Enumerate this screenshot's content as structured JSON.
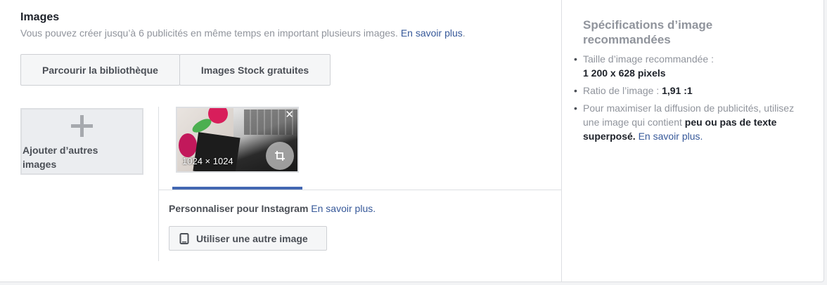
{
  "section": {
    "title": "Images",
    "subtitle": "Vous pouvez créer jusqu’à 6 publicités en même temps en important plusieurs images.",
    "learn_more": "En savoir plus",
    "period": "."
  },
  "buttons": {
    "browse_library": "Parcourir la bibliothèque",
    "stock_images": "Images Stock gratuites",
    "use_other_image": "Utiliser une autre image"
  },
  "add_images": {
    "label": "Ajouter d’autres images"
  },
  "thumbnail": {
    "dimensions": "1024 × 1024",
    "close_glyph": "✕"
  },
  "instagram": {
    "label": "Personnaliser pour Instagram",
    "learn_more": "En savoir plus."
  },
  "specs": {
    "title": "Spécifications d’image recommandées",
    "items": [
      {
        "text": "Taille d’image recommandée :",
        "bold": "1 200 x 628 pixels"
      },
      {
        "text": "Ratio de l’image :",
        "bold": "1,91 :1"
      },
      {
        "text": "Pour maximiser la diffusion de publicités, utilisez une image qui contient",
        "bold": "peu ou pas de texte superposé.",
        "link": "En savoir plus."
      }
    ]
  },
  "colors": {
    "link": "#365899",
    "tab_active": "#4267b2",
    "muted_text": "#90949c"
  },
  "icons": [
    "plus-icon",
    "close-icon",
    "crop-icon",
    "phone-icon"
  ]
}
